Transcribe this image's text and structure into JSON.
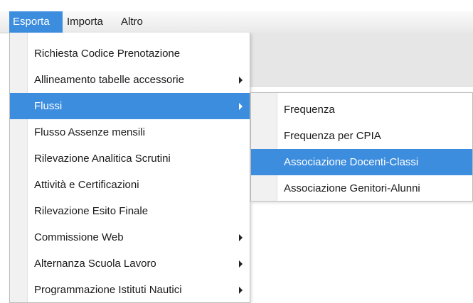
{
  "menubar": {
    "items": [
      {
        "label": "Esporta"
      },
      {
        "label": "Importa"
      },
      {
        "label": "Altro"
      }
    ]
  },
  "esporta_menu": {
    "items": [
      {
        "label": "Richiesta Codice Prenotazione"
      },
      {
        "label": "Allineamento tabelle accessorie"
      },
      {
        "label": "Flussi"
      },
      {
        "label": "Flusso Assenze mensili"
      },
      {
        "label": "Rilevazione Analitica Scrutini"
      },
      {
        "label": "Attività e Certificazioni"
      },
      {
        "label": "Rilevazione Esito Finale"
      },
      {
        "label": "Commissione Web"
      },
      {
        "label": "Alternanza Scuola Lavoro"
      },
      {
        "label": "Programmazione Istituti Nautici"
      }
    ]
  },
  "flussi_submenu": {
    "items": [
      {
        "label": "Frequenza"
      },
      {
        "label": "Frequenza per CPIA"
      },
      {
        "label": "Associazione Docenti-Classi"
      },
      {
        "label": "Associazione Genitori-Alunni"
      }
    ]
  },
  "colors": {
    "highlight": "#3c8dde",
    "highlight_text": "#ffffff"
  }
}
